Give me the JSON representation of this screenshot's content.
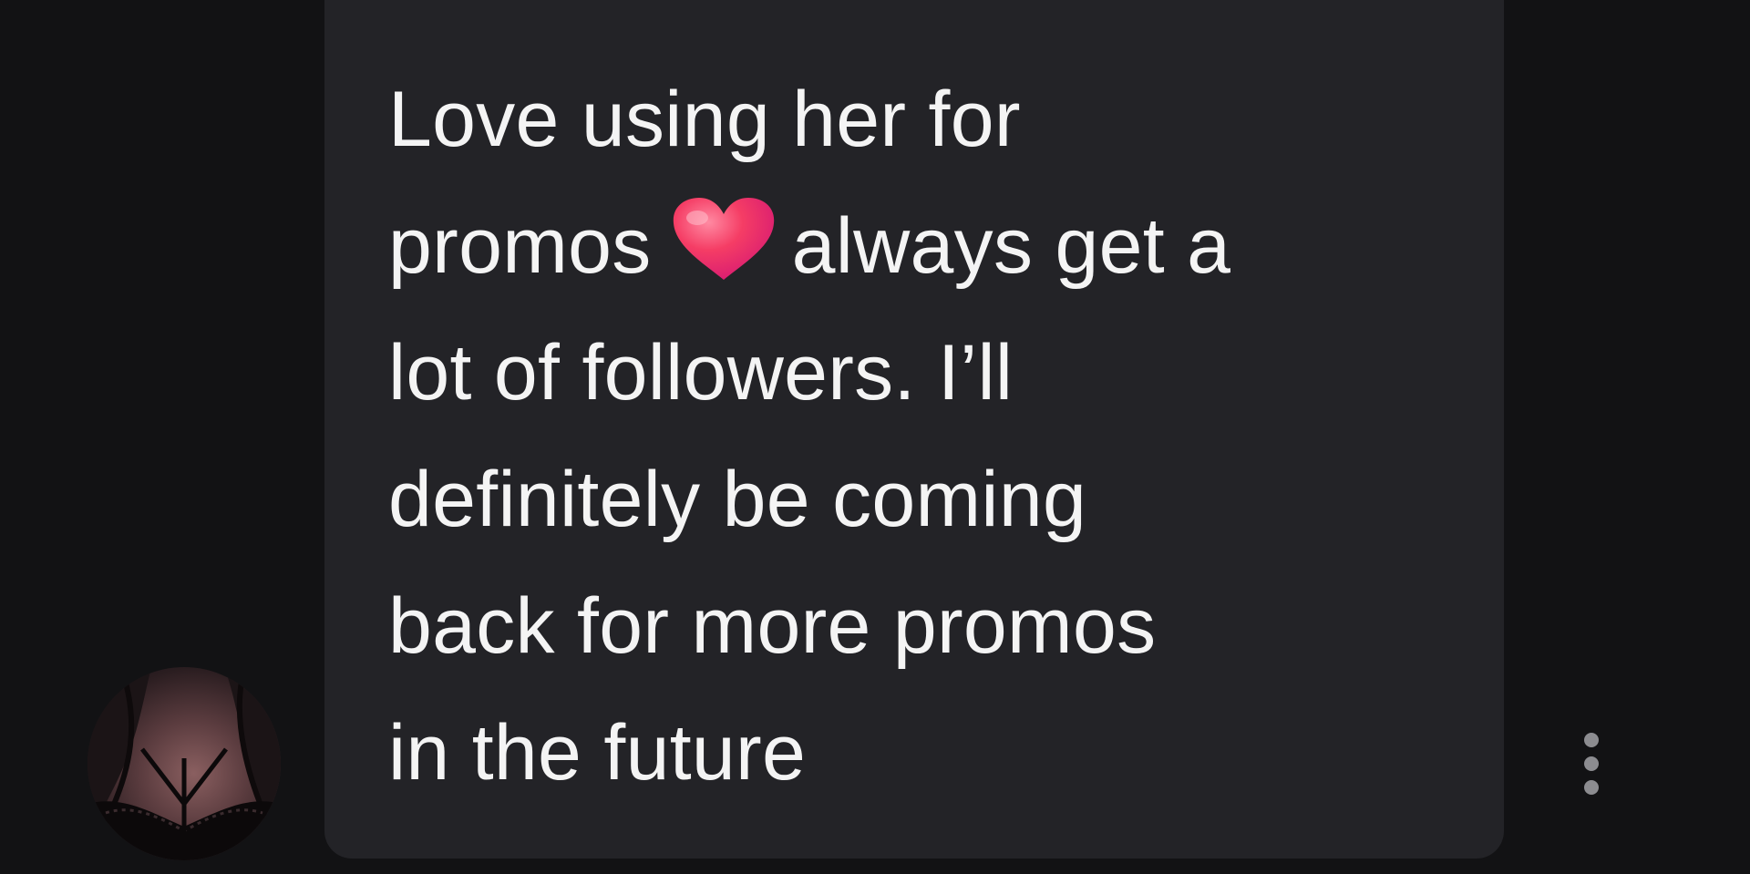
{
  "message": {
    "line1": "Love using her for",
    "line2_before_emoji": "promos",
    "emoji": "heart-emoji",
    "line2_after_emoji": "always get a",
    "line3": "lot of followers. I’ll",
    "line4": "definitely be coming",
    "line5": "back for more promos",
    "line6": "in the future"
  },
  "colors": {
    "background": "#121214",
    "bubble": "#232327",
    "text": "#f4f4f4",
    "heart": "#f23a66",
    "more_dots": "#8c8c90"
  },
  "icons": {
    "more": "more-vertical-icon",
    "avatar": "user-avatar-photo"
  }
}
